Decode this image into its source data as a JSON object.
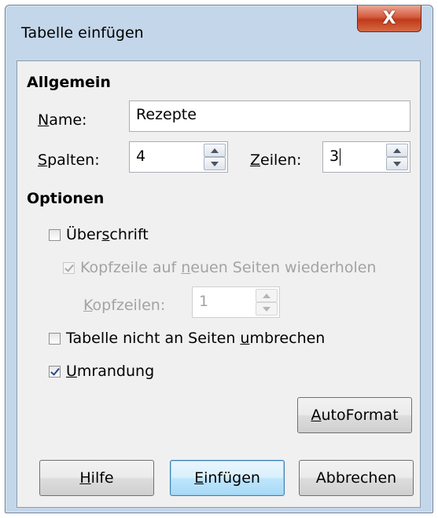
{
  "window": {
    "title": "Tabelle einfügen",
    "close_label": "X"
  },
  "general": {
    "heading": "Allgemein",
    "name_label_u": "N",
    "name_label_rest": "ame:",
    "name_value": "Rezepte",
    "columns_label_u": "S",
    "columns_label_rest": "palten:",
    "columns_value": "4",
    "rows_label_u": "Z",
    "rows_label_rest": "eilen:",
    "rows_value": "3"
  },
  "options": {
    "heading": "Optionen",
    "heading_cb": {
      "pre": "Über",
      "u": "s",
      "post": "chrift",
      "checked": false
    },
    "repeat_header_cb": {
      "pre": "Kopfzeile auf ",
      "u": "n",
      "post": "euen Seiten wiederholen",
      "checked": true,
      "disabled": true
    },
    "header_rows_label_u": "K",
    "header_rows_label_rest": "opfzeilen:",
    "header_rows_value": "1",
    "no_split_cb": {
      "pre": "Tabelle nicht an Seiten ",
      "u": "u",
      "post": "mbrechen",
      "checked": false
    },
    "border_cb": {
      "pre": "",
      "u": "U",
      "post": "mrandung",
      "checked": true
    }
  },
  "buttons": {
    "autoformat_u": "A",
    "autoformat_rest": "utoFormat",
    "help_u": "H",
    "help_rest": "ilfe",
    "insert_u": "E",
    "insert_rest": "infügen",
    "cancel": "Abbrechen"
  }
}
